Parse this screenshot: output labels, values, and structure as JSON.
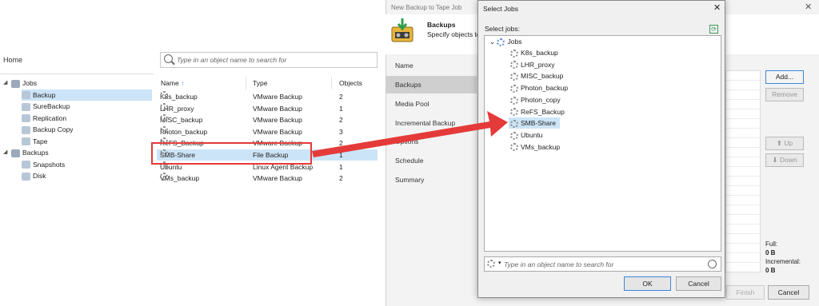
{
  "left": {
    "home": "Home",
    "tree": [
      {
        "label": "Jobs",
        "indent": 0,
        "expanded": true
      },
      {
        "label": "Backup",
        "indent": 1,
        "selected": true
      },
      {
        "label": "SureBackup",
        "indent": 1
      },
      {
        "label": "Replication",
        "indent": 1
      },
      {
        "label": "Backup Copy",
        "indent": 1
      },
      {
        "label": "Tape",
        "indent": 1
      },
      {
        "label": "Backups",
        "indent": 0,
        "expanded": true
      },
      {
        "label": "Snapshots",
        "indent": 1
      },
      {
        "label": "Disk",
        "indent": 1
      }
    ],
    "search_placeholder": "Type in an object name to search for",
    "columns": {
      "name": "Name",
      "type": "Type",
      "objects": "Objects"
    },
    "sort_indicator": "↑",
    "jobs": [
      {
        "name": "K8s_backup",
        "type": "VMware Backup",
        "objects": "2"
      },
      {
        "name": "LHR_proxy",
        "type": "VMware Backup",
        "objects": "1"
      },
      {
        "name": "MISC_backup",
        "type": "VMware Backup",
        "objects": "2"
      },
      {
        "name": "Photon_backup",
        "type": "VMware Backup",
        "objects": "3"
      },
      {
        "name": "ReFS_Backup",
        "type": "VMware Backup",
        "objects": "2"
      },
      {
        "name": "SMB-Share",
        "type": "File Backup",
        "objects": "1",
        "selected": true
      },
      {
        "name": "Ubuntu",
        "type": "Linux Agent Backup",
        "objects": "1"
      },
      {
        "name": "VMs_backup",
        "type": "VMware Backup",
        "objects": "2"
      }
    ]
  },
  "wizard": {
    "title": "New Backup to Tape Job",
    "close": "✕",
    "heading": "Backups",
    "subheading": "Specify objects to",
    "steps": [
      "Name",
      "Backups",
      "Media Pool",
      "Incremental Backup",
      "Options",
      "Schedule",
      "Summary"
    ],
    "selected_step": "Backups",
    "buttons": {
      "add": "Add...",
      "remove": "Remove",
      "up": "Up",
      "down": "Down",
      "finish": "Finish",
      "cancel": "Cancel"
    },
    "sizes": {
      "full_label": "Full:",
      "full_value": "0 B",
      "incremental_label": "Incremental:",
      "incremental_value": "0 B"
    }
  },
  "dialog": {
    "title": "Select Jobs",
    "close": "✕",
    "label": "Select jobs:",
    "root": "Jobs",
    "items": [
      "K8s_backup",
      "LHR_proxy",
      "MISC_backup",
      "Photon_backup",
      "Photon_copy",
      "ReFS_Backup",
      "SMB-Share",
      "Ubuntu",
      "VMs_backup"
    ],
    "selected": "SMB-Share",
    "search_placeholder": "Type in an object name to search for",
    "ok": "OK",
    "cancel": "Cancel"
  },
  "colors": {
    "selection": "#cce4f7",
    "highlight": "#e53a3a",
    "accent": "#3b86d8"
  }
}
